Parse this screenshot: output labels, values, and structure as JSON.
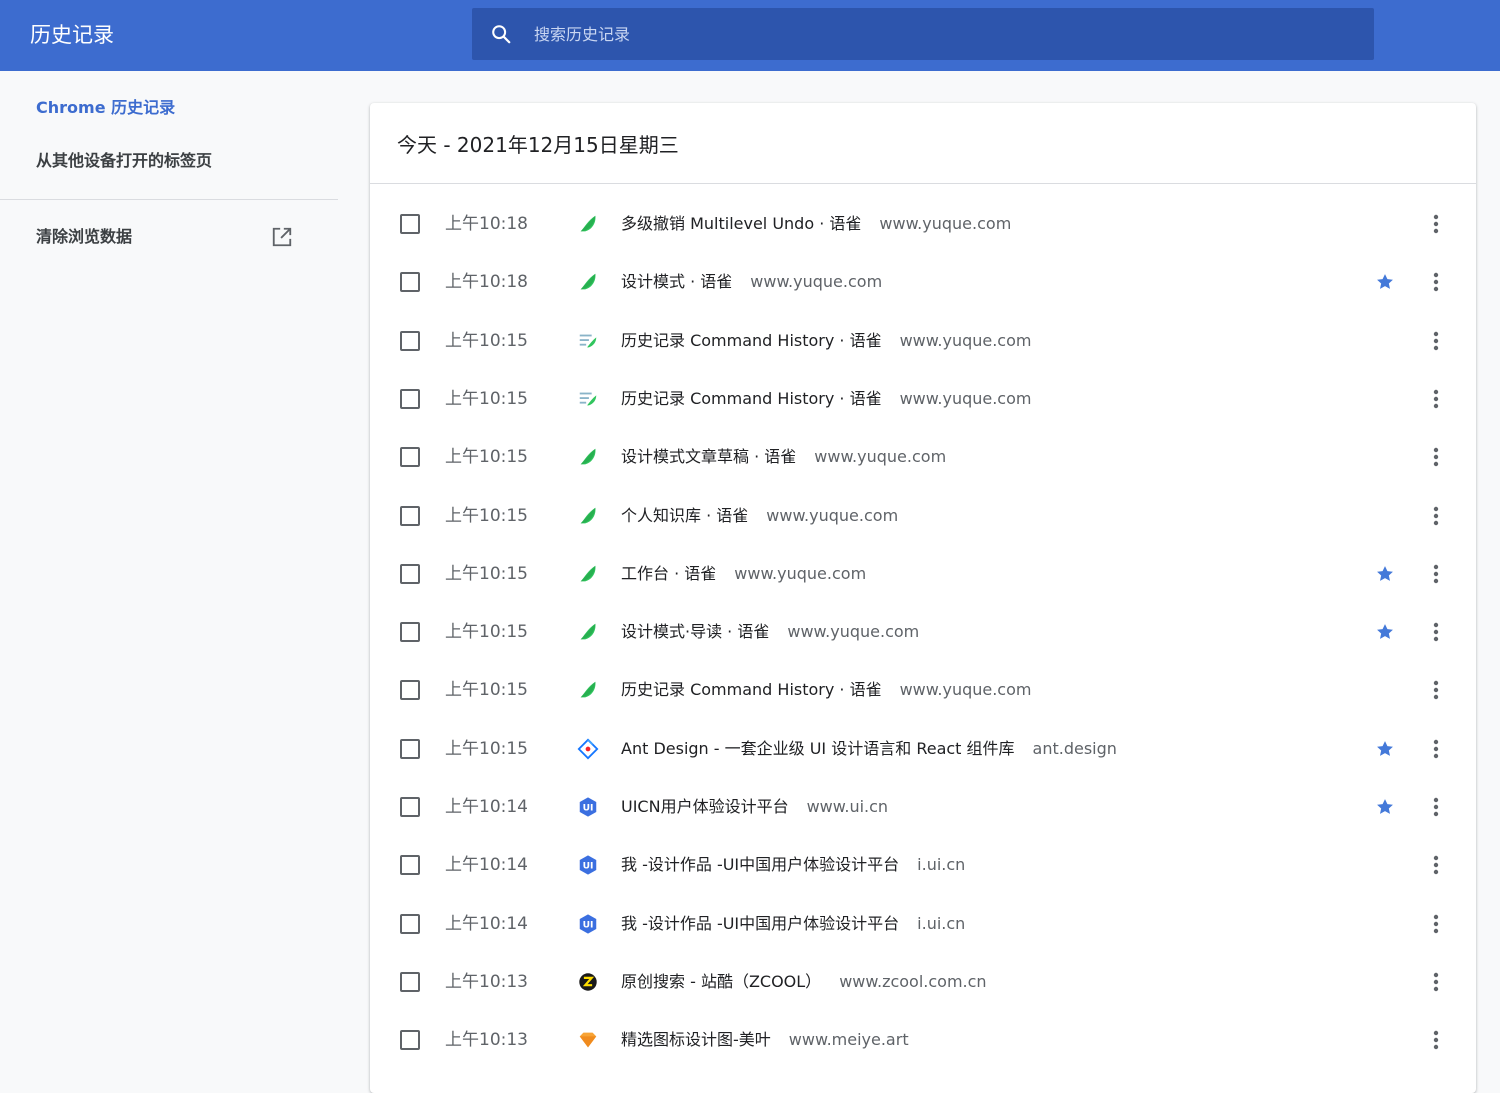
{
  "header": {
    "title": "历史记录",
    "search_placeholder": "搜索历史记录"
  },
  "sidebar": {
    "items": [
      {
        "label": "Chrome 历史记录",
        "active": true
      },
      {
        "label": "从其他设备打开的标签页",
        "active": false
      },
      {
        "label": "清除浏览数据",
        "active": false
      }
    ]
  },
  "main": {
    "date_heading": "今天 - 2021年12月15日星期三",
    "entries": [
      {
        "time": "上午10:18",
        "title": "多级撤销 Multilevel Undo · 语雀",
        "domain": "www.yuque.com",
        "icon": "yuque-icon",
        "starred": false
      },
      {
        "time": "上午10:18",
        "title": "设计模式 · 语雀",
        "domain": "www.yuque.com",
        "icon": "yuque-icon",
        "starred": true
      },
      {
        "time": "上午10:15",
        "title": "历史记录 Command History · 语雀",
        "domain": "www.yuque.com",
        "icon": "yuque-doc-icon",
        "starred": false
      },
      {
        "time": "上午10:15",
        "title": "历史记录 Command History · 语雀",
        "domain": "www.yuque.com",
        "icon": "yuque-doc-icon",
        "starred": false
      },
      {
        "time": "上午10:15",
        "title": "设计模式文章草稿 · 语雀",
        "domain": "www.yuque.com",
        "icon": "yuque-icon",
        "starred": false
      },
      {
        "time": "上午10:15",
        "title": "个人知识库 · 语雀",
        "domain": "www.yuque.com",
        "icon": "yuque-icon",
        "starred": false
      },
      {
        "time": "上午10:15",
        "title": "工作台 · 语雀",
        "domain": "www.yuque.com",
        "icon": "yuque-icon",
        "starred": true
      },
      {
        "time": "上午10:15",
        "title": "设计模式·导读 · 语雀",
        "domain": "www.yuque.com",
        "icon": "yuque-icon",
        "starred": true
      },
      {
        "time": "上午10:15",
        "title": "历史记录 Command History · 语雀",
        "domain": "www.yuque.com",
        "icon": "yuque-icon",
        "starred": false
      },
      {
        "time": "上午10:15",
        "title": "Ant Design - 一套企业级 UI 设计语言和 React 组件库",
        "domain": "ant.design",
        "icon": "antd-icon",
        "starred": true
      },
      {
        "time": "上午10:14",
        "title": "UICN用户体验设计平台",
        "domain": "www.ui.cn",
        "icon": "uicn-icon",
        "starred": true
      },
      {
        "time": "上午10:14",
        "title": "我 -设计作品 -UI中国用户体验设计平台",
        "domain": "i.ui.cn",
        "icon": "uicn-icon",
        "starred": false
      },
      {
        "time": "上午10:14",
        "title": "我 -设计作品 -UI中国用户体验设计平台",
        "domain": "i.ui.cn",
        "icon": "uicn-icon",
        "starred": false
      },
      {
        "time": "上午10:13",
        "title": "原创搜索 - 站酷（ZCOOL）",
        "domain": "www.zcool.com.cn",
        "icon": "zcool-icon",
        "starred": false
      },
      {
        "time": "上午10:13",
        "title": "精选图标设计图-美叶",
        "domain": "www.meiye.art",
        "icon": "meiye-icon",
        "starred": false
      }
    ]
  },
  "colors": {
    "topbar": "#3d6ccf",
    "search_bg": "#2d55ad",
    "accent": "#3d6ccf",
    "star": "#4479d9"
  }
}
